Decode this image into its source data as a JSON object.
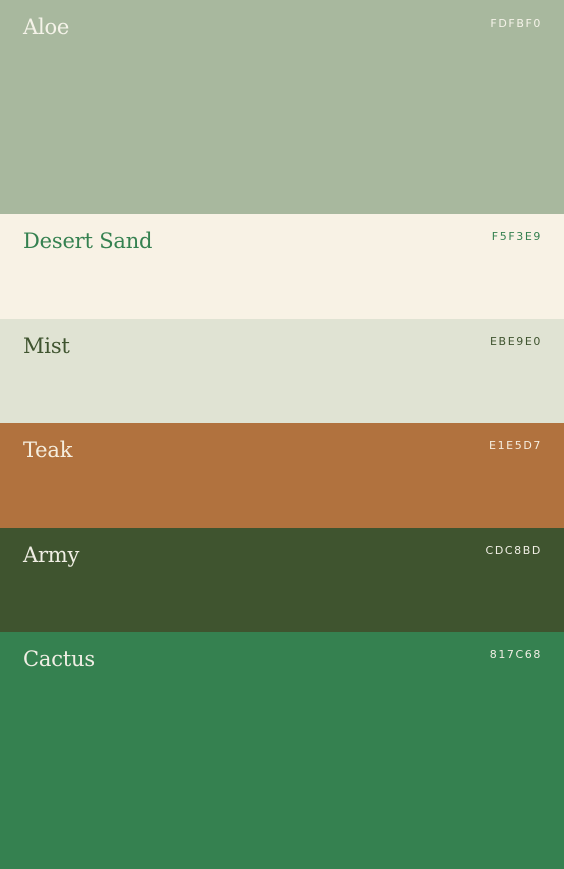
{
  "swatches": [
    {
      "id": "aloe",
      "name": "Aloe",
      "code": "FDFBF0",
      "background": "#A8B89E",
      "name_color": "#F5F3E9",
      "code_color": "#F5F3E9"
    },
    {
      "id": "desert",
      "name": "Desert Sand",
      "code": "F5F3E9",
      "background": "#F8F2E5",
      "name_color": "#358150",
      "code_color": "#358150"
    },
    {
      "id": "mist",
      "name": "Mist",
      "code": "EBE9E0",
      "background": "#E0E3D3",
      "name_color": "#3F542F",
      "code_color": "#3F542F"
    },
    {
      "id": "teak",
      "name": "Teak",
      "code": "E1E5D7",
      "background": "#B1723E",
      "name_color": "#F5EEDF",
      "code_color": "#F5EEDF"
    },
    {
      "id": "army",
      "name": "Army",
      "code": "CDC8BD",
      "background": "#3F542F",
      "name_color": "#F0EEE4",
      "code_color": "#F0EEE4"
    },
    {
      "id": "cactus",
      "name": "Cactus",
      "code": "817C68",
      "background": "#358150",
      "name_color": "#F0EEE4",
      "code_color": "#F0EEE4"
    }
  ]
}
